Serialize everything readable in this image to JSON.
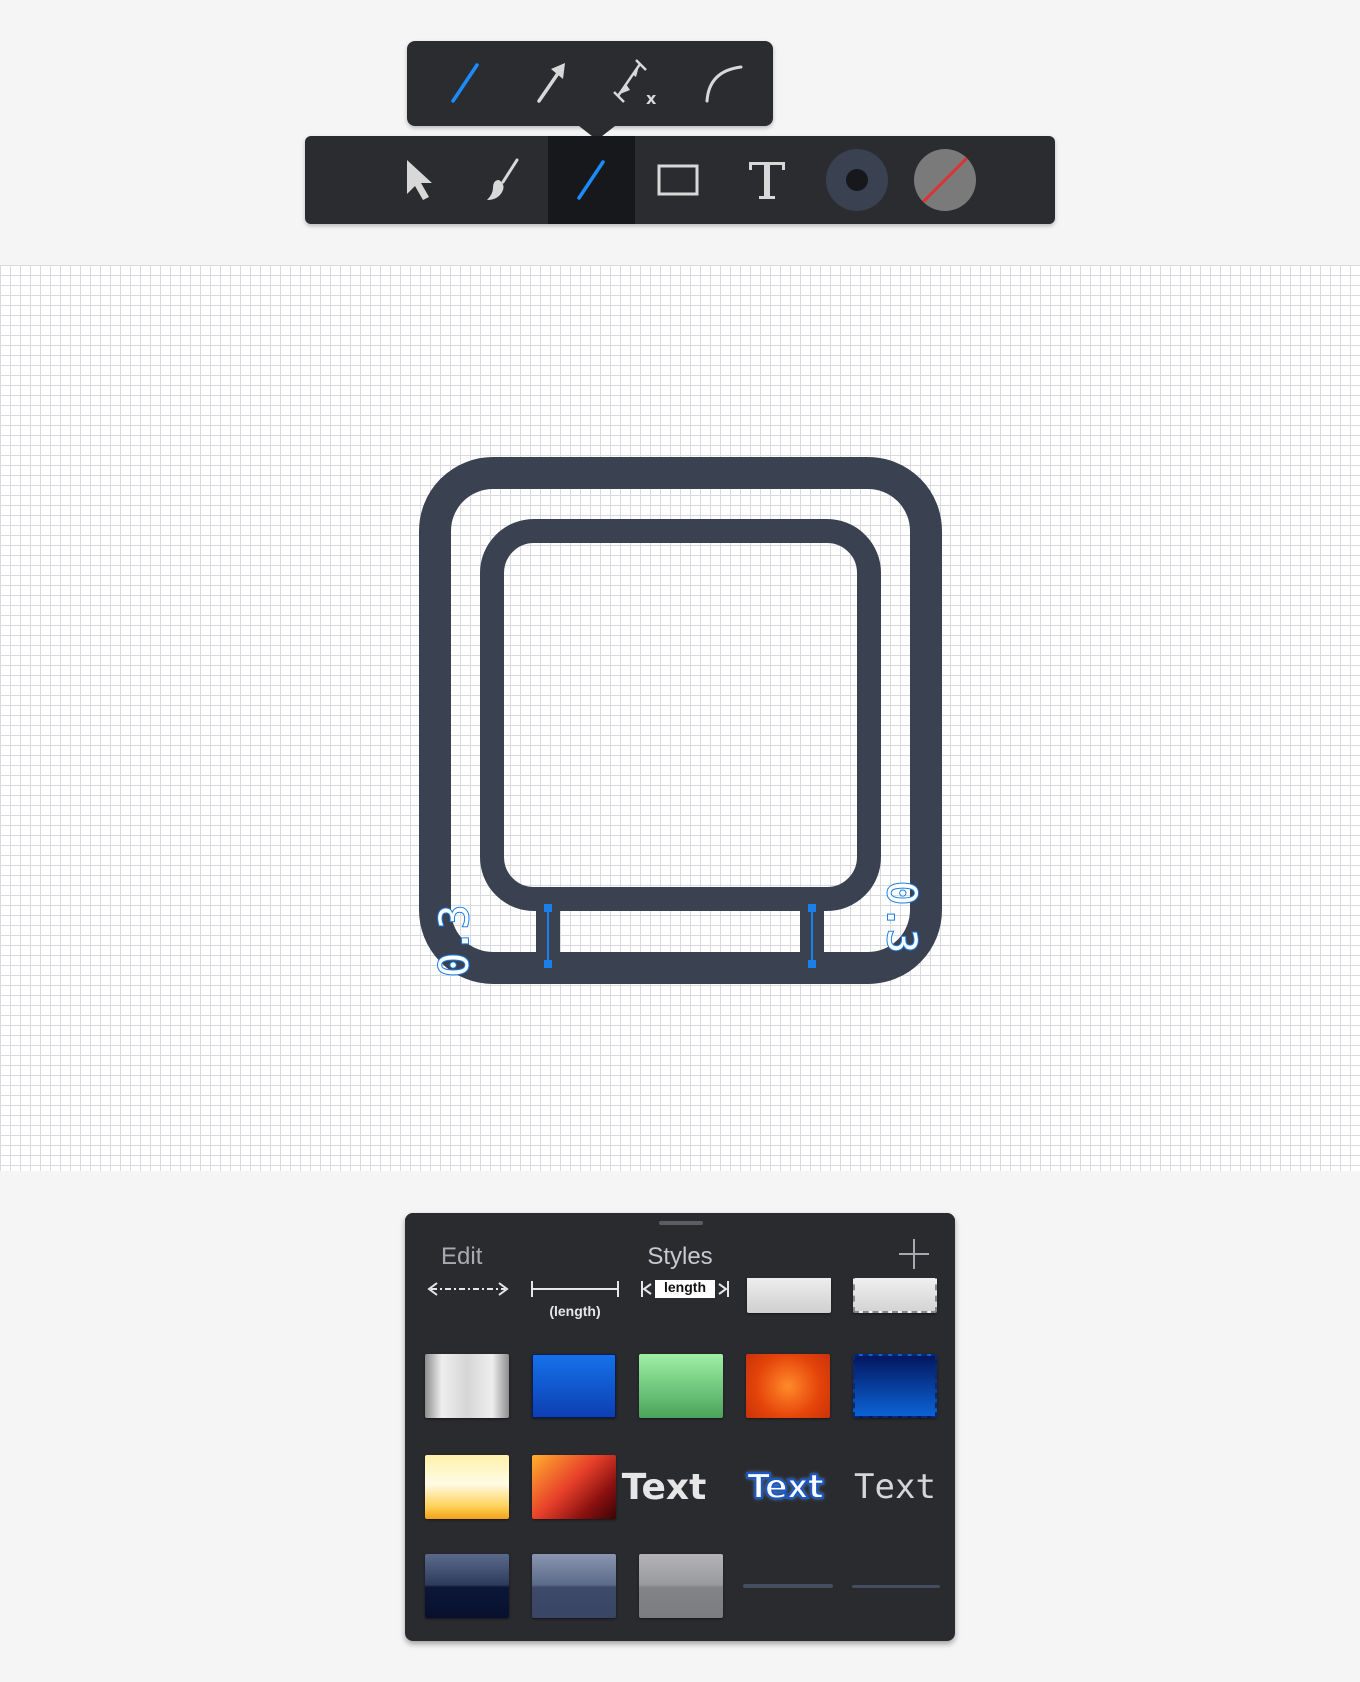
{
  "sub_toolbar": {
    "tools": [
      {
        "name": "line-tool",
        "icon": "line-icon",
        "active": true
      },
      {
        "name": "arrow-tool",
        "icon": "arrow-icon",
        "active": false
      },
      {
        "name": "dimension-tool",
        "icon": "dimension-icon",
        "active": false
      },
      {
        "name": "arc-tool",
        "icon": "arc-icon",
        "active": false
      }
    ]
  },
  "main_toolbar": {
    "tools": [
      {
        "name": "select-tool",
        "icon": "pointer-icon"
      },
      {
        "name": "brush-tool",
        "icon": "brush-icon"
      },
      {
        "name": "line-tool",
        "icon": "line-icon",
        "active": true
      },
      {
        "name": "rectangle-tool",
        "icon": "rectangle-icon"
      },
      {
        "name": "text-tool",
        "icon": "text-icon"
      },
      {
        "name": "stroke-color",
        "icon": "stroke-color-icon",
        "color": "#3a4150"
      },
      {
        "name": "fill-color",
        "icon": "no-fill-icon",
        "color": "#7a7a7a"
      }
    ],
    "accent": "#1a8cff"
  },
  "canvas": {
    "shape_color": "#3a4150",
    "selection_color": "#1a7fe8",
    "dimension_labels": {
      "left": "0.3",
      "right": "0.3"
    }
  },
  "styles_panel": {
    "edit_label": "Edit",
    "title": "Styles",
    "add_icon": "plus-icon",
    "dimension_length_label": "(length)",
    "dimension_inline_label": "length",
    "text_styles": {
      "bold": "Text",
      "fancy": "Text",
      "mono": "Text"
    }
  }
}
